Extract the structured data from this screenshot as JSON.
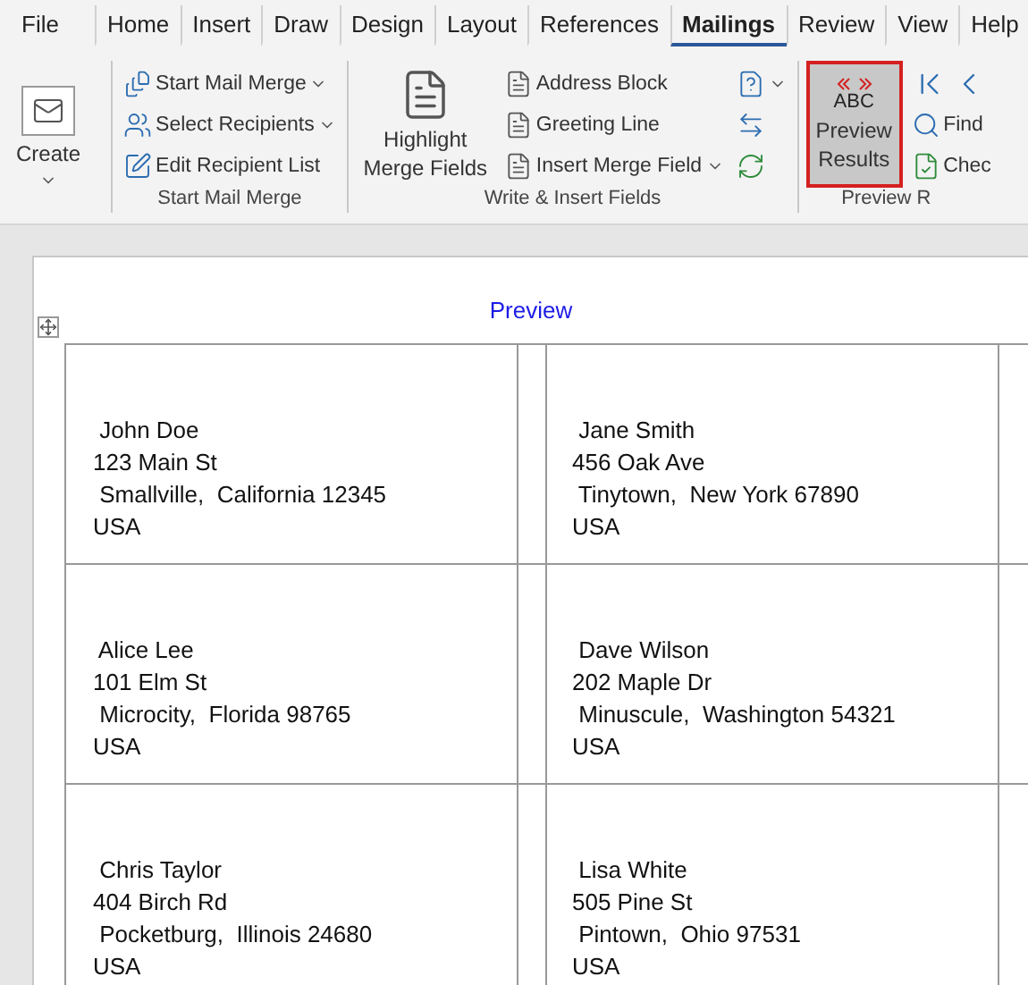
{
  "tabs": [
    {
      "label": "File",
      "selected": false
    },
    {
      "label": "Home",
      "selected": false
    },
    {
      "label": "Insert",
      "selected": false
    },
    {
      "label": "Draw",
      "selected": false
    },
    {
      "label": "Design",
      "selected": false
    },
    {
      "label": "Layout",
      "selected": false
    },
    {
      "label": "References",
      "selected": false
    },
    {
      "label": "Mailings",
      "selected": true
    },
    {
      "label": "Review",
      "selected": false
    },
    {
      "label": "View",
      "selected": false
    },
    {
      "label": "Help",
      "selected": false
    }
  ],
  "create_button": {
    "label": "Create"
  },
  "start_mail_merge": {
    "label": "Start Mail Merge",
    "items": [
      {
        "label": "Start Mail Merge",
        "dropdown": true
      },
      {
        "label": "Select Recipients",
        "dropdown": true
      },
      {
        "label": "Edit Recipient List",
        "dropdown": false
      }
    ]
  },
  "write_insert": {
    "label": "Write & Insert Fields",
    "highlight_button": {
      "label": "Highlight Merge Fields"
    },
    "items": [
      {
        "label": "Address Block",
        "dropdown": false
      },
      {
        "label": "Greeting Line",
        "dropdown": false
      },
      {
        "label": "Insert Merge Field",
        "dropdown": true
      }
    ]
  },
  "preview_results": {
    "label": "Preview R",
    "button": {
      "icon_text": "ABC",
      "label": "Preview Results",
      "selected": true
    },
    "items": [
      "Find",
      "Chec"
    ]
  },
  "document": {
    "heading": "Preview",
    "labels": [
      {
        "lines": [
          " John Doe",
          "123 Main St",
          " Smallville,  California 12345",
          "USA"
        ]
      },
      {
        "lines": [
          " Jane Smith",
          "456 Oak Ave",
          " Tinytown,  New York 67890",
          "USA"
        ]
      },
      {
        "lines": [
          " Alice Lee",
          "101 Elm St",
          " Microcity,  Florida 98765",
          "USA"
        ]
      },
      {
        "lines": [
          " Dave Wilson",
          "202 Maple Dr",
          " Minuscule,  Washington 54321",
          "USA"
        ]
      },
      {
        "lines": [
          " Chris Taylor",
          "404 Birch Rd",
          " Pocketburg,  Illinois 24680",
          "USA"
        ]
      },
      {
        "lines": [
          " Lisa White",
          "505 Pine St",
          " Pintown,  Ohio 97531",
          "USA"
        ]
      }
    ]
  }
}
